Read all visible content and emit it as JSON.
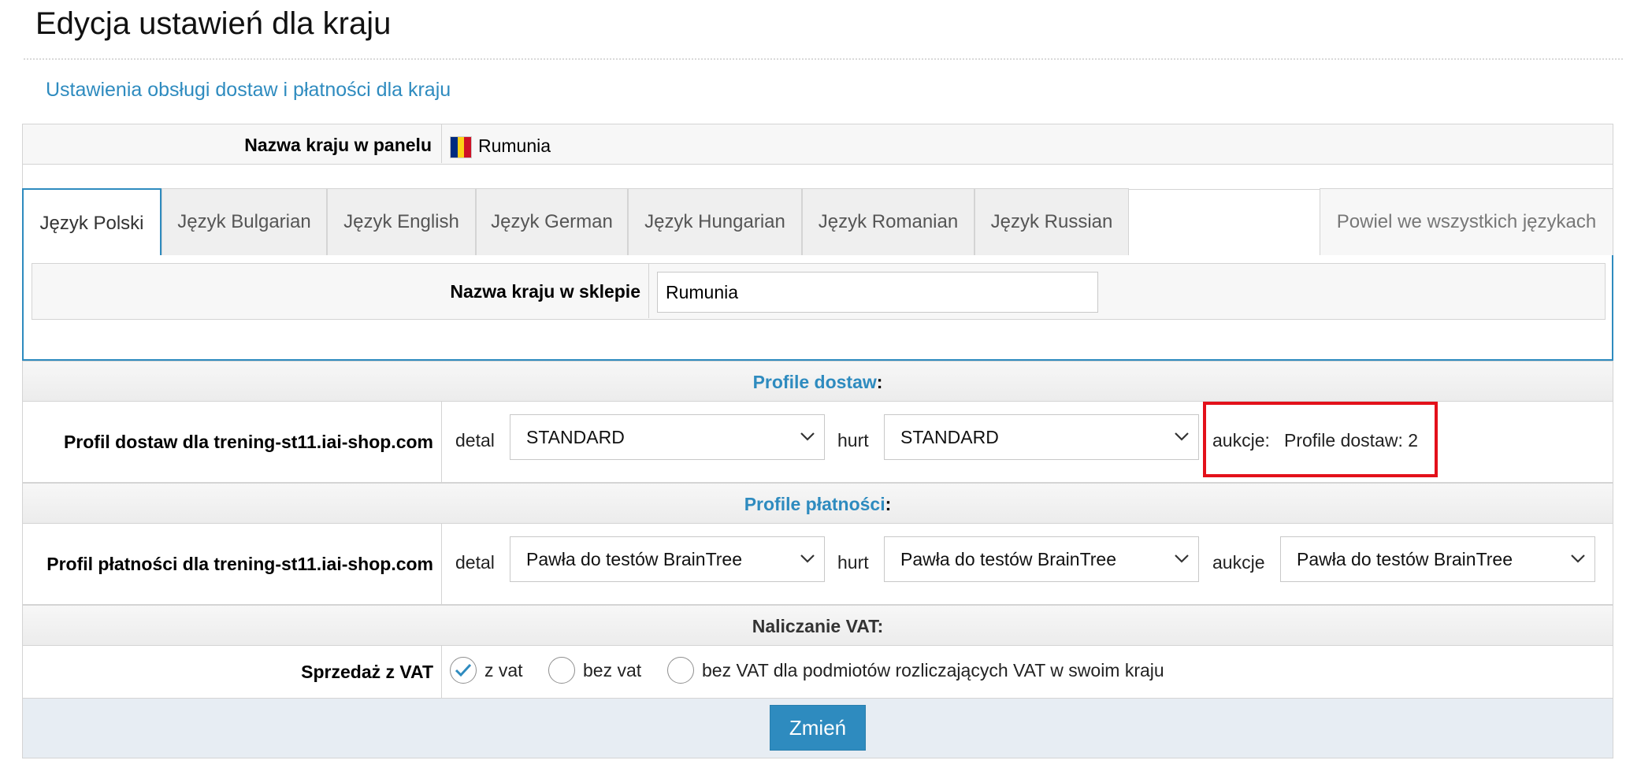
{
  "page": {
    "title": "Edycja ustawień dla kraju",
    "subtitle": "Ustawienia obsługi dostaw i płatności dla kraju"
  },
  "panel": {
    "label": "Nazwa kraju w panelu",
    "value": "Rumunia",
    "flag_colors": [
      "#002B7F",
      "#FCD116",
      "#CE1126"
    ]
  },
  "tabs": {
    "items": [
      {
        "label": "Język Polski",
        "active": true
      },
      {
        "label": "Język Bulgarian",
        "active": false
      },
      {
        "label": "Język English",
        "active": false
      },
      {
        "label": "Język German",
        "active": false
      },
      {
        "label": "Język Hungarian",
        "active": false
      },
      {
        "label": "Język Romanian",
        "active": false
      },
      {
        "label": "Język Russian",
        "active": false
      }
    ],
    "copy_all": "Powiel we wszystkich językach"
  },
  "shop": {
    "label": "Nazwa kraju w sklepie",
    "value": "Rumunia"
  },
  "delivery": {
    "header": "Profile dostaw",
    "header_suffix": ":",
    "row_label": "Profil dostaw dla trening-st11.iai-shop.com",
    "detal_label": "detal",
    "detal_value": "STANDARD",
    "hurt_label": "hurt",
    "hurt_value": "STANDARD",
    "auctions_label": "aukcje:",
    "auctions_link": "Profile dostaw: 2"
  },
  "payment": {
    "header": "Profile płatności",
    "header_suffix": ":",
    "row_label": "Profil płatności dla trening-st11.iai-shop.com",
    "detal_label": "detal",
    "detal_value": "Pawła do testów BrainTree",
    "hurt_label": "hurt",
    "hurt_value": "Pawła do testów BrainTree",
    "auctions_label": "aukcje",
    "auctions_value": "Pawła do testów BrainTree"
  },
  "vat": {
    "header": "Naliczanie VAT:",
    "row_label": "Sprzedaż z VAT",
    "options": [
      {
        "label": "z vat",
        "checked": true
      },
      {
        "label": "bez vat",
        "checked": false
      },
      {
        "label": "bez VAT dla podmiotów rozliczających VAT w swoim kraju",
        "checked": false
      }
    ]
  },
  "actions": {
    "submit_label": "Zmień"
  },
  "colors": {
    "accent": "#2e8bbf",
    "highlight": "#e3101a"
  }
}
